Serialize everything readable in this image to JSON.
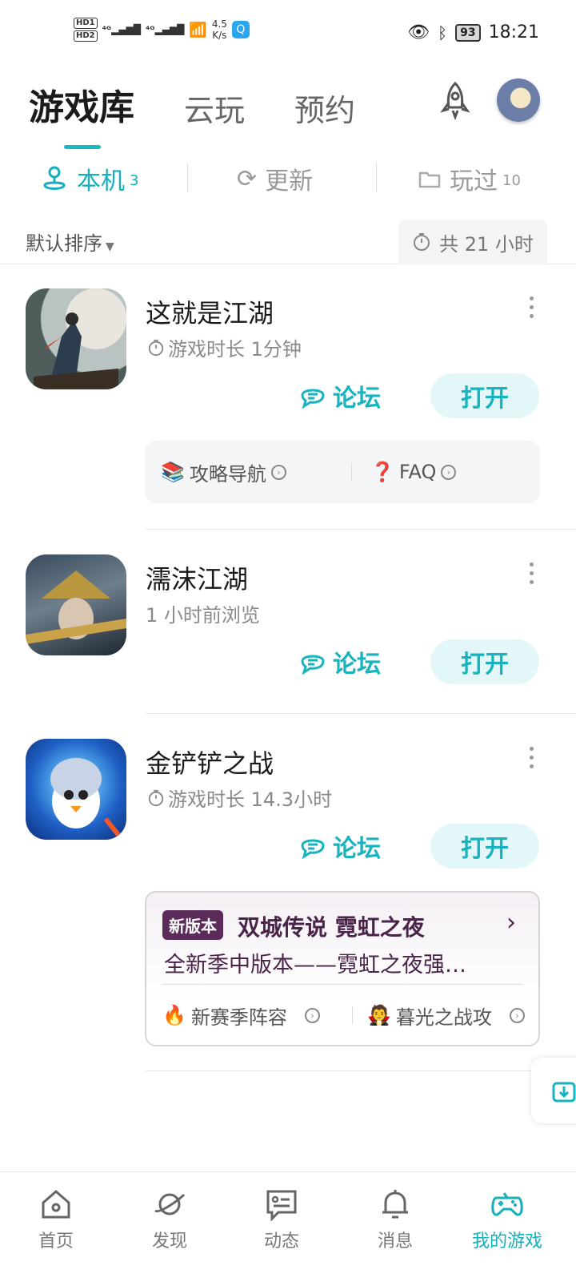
{
  "status_bar": {
    "speed_value": "4.5",
    "speed_unit": "K/s",
    "battery": "93",
    "time": "18:21"
  },
  "top_tabs": [
    "游戏库",
    "云玩",
    "预约"
  ],
  "sub_tabs": [
    {
      "label": "本机",
      "count": "3"
    },
    {
      "label": "更新",
      "count": ""
    },
    {
      "label": "玩过",
      "count": "10"
    }
  ],
  "sort": {
    "label": "默认排序",
    "total": "共 21 小时"
  },
  "games": [
    {
      "name": "这就是江湖",
      "meta": "游戏时长 1分钟",
      "forum": "论坛",
      "open": "打开",
      "guides": [
        {
          "emoji": "📚",
          "label": "攻略导航"
        },
        {
          "emoji": "❓",
          "label": "FAQ"
        }
      ]
    },
    {
      "name": "濡沫江湖",
      "meta": "1 小时前浏览",
      "forum": "论坛",
      "open": "打开"
    },
    {
      "name": "金铲铲之战",
      "meta": "游戏时长 14.3小时",
      "forum": "论坛",
      "open": "打开",
      "news": {
        "tag": "新版本",
        "title": "双城传说 霓虹之夜",
        "desc": "全新季中版本——霓虹之夜强…",
        "links": [
          {
            "emoji": "🔥",
            "label": "新赛季阵容"
          },
          {
            "emoji": "🧛",
            "label": "暮光之战攻"
          }
        ]
      }
    }
  ],
  "bottom_nav": [
    "首页",
    "发现",
    "动态",
    "消息",
    "我的游戏"
  ],
  "colors": {
    "accent": "#16b0bd",
    "news_text": "#4a2448",
    "news_tag": "#5a2b58"
  }
}
